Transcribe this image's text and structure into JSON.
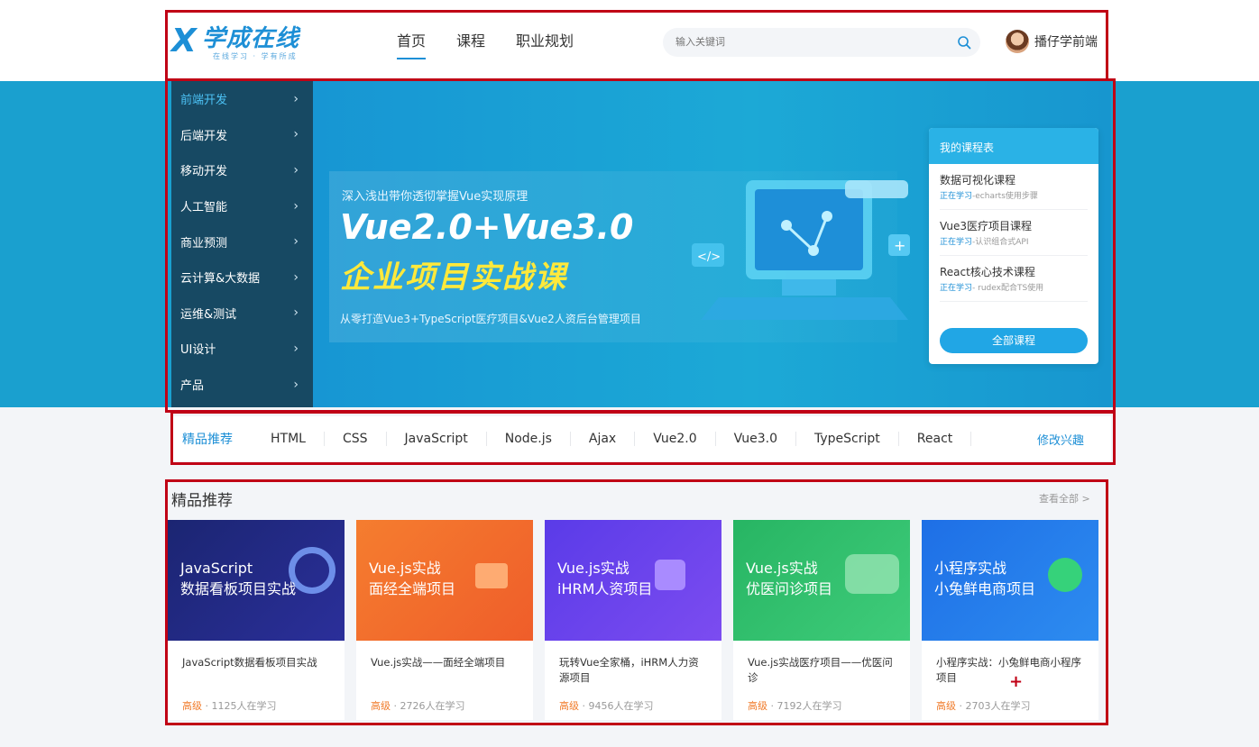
{
  "header": {
    "logo_name": "学成在线",
    "logo_mark": "X",
    "logo_tagline": "在线学习 · 学有所成",
    "nav": [
      "首页",
      "课程",
      "职业规划"
    ],
    "active_nav": "首页",
    "search_placeholder": "输入关键词",
    "search_icon": "search-icon",
    "user_name": "播仔学前端"
  },
  "banner": {
    "categories": [
      "前端开发",
      "后端开发",
      "移动开发",
      "人工智能",
      "商业预测",
      "云计算&大数据",
      "运维&测试",
      "UI设计",
      "产品"
    ],
    "active_category": "前端开发",
    "hero": {
      "subtitle": "深入浅出带你透彻掌握Vue实现原理",
      "title": "Vue2.0+Vue3.0",
      "title2": "企业项目实战课",
      "desc": "从零打造Vue3+TypeScript医疗项目&Vue2人资后台管理项目"
    },
    "schedule": {
      "title": "我的课程表",
      "items": [
        {
          "name": "数据可视化课程",
          "status": "正在学习",
          "detail": "-echarts使用步骤"
        },
        {
          "name": "Vue3医疗项目课程",
          "status": "正在学习",
          "detail": "-认识组合式API"
        },
        {
          "name": "React核心技术课程",
          "status": "正在学习",
          "detail": "- rudex配合TS使用"
        }
      ],
      "button": "全部课程"
    }
  },
  "tagbar": {
    "label": "精品推荐",
    "tags": [
      "HTML",
      "CSS",
      "JavaScript",
      "Node.js",
      "Ajax",
      "Vue2.0",
      "Vue3.0",
      "TypeScript",
      "React"
    ],
    "edit": "修改兴趣"
  },
  "recommend": {
    "title": "精品推荐",
    "more": "查看全部 >",
    "courses": [
      {
        "line1": "JavaScript",
        "line2": "数据看板项目实战",
        "name": "JavaScript数据看板项目实战",
        "level": "高级",
        "learners": "1125人在学习",
        "color": "#1d2a7a"
      },
      {
        "line1": "Vue.js实战",
        "line2": "面经全端项目",
        "name": "Vue.js实战——面经全端项目",
        "level": "高级",
        "learners": "2726人在学习",
        "color": "#f2702d"
      },
      {
        "line1": "Vue.js实战",
        "line2": "iHRM人资项目",
        "name": "玩转Vue全家桶，iHRM人力资源项目",
        "level": "高级",
        "learners": "9456人在学习",
        "color": "#6a3fe6"
      },
      {
        "line1": "Vue.js实战",
        "line2": "优医问诊项目",
        "name": "Vue.js实战医疗项目——优医问诊",
        "level": "高级",
        "learners": "7192人在学习",
        "color": "#2fbf6c"
      },
      {
        "line1": "小程序实战",
        "line2": "小兔鲜电商项目",
        "name": "小程序实战：小兔鲜电商小程序项目",
        "level": "高级",
        "learners": "2703人在学习",
        "color": "#1f72e8"
      }
    ]
  },
  "colors": {
    "accent": "#1d8fd6",
    "banner_bg": "#1aa0cf",
    "sidebar_bg": "#173c54",
    "highlight_yellow": "#ffe93b",
    "outline_red": "#c00015",
    "level_orange": "#f07b2a"
  }
}
